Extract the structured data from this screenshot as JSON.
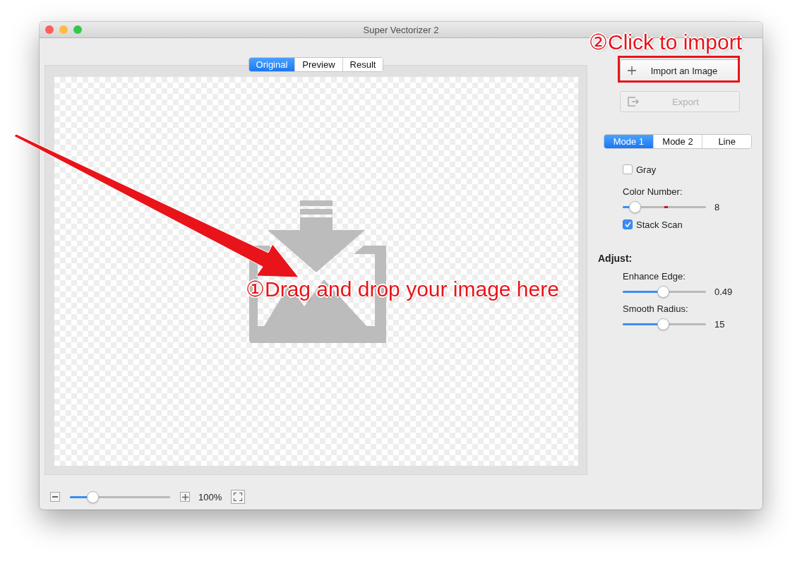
{
  "window": {
    "title": "Super Vectorizer 2"
  },
  "view_tabs": [
    {
      "label": "Original",
      "selected": true
    },
    {
      "label": "Preview",
      "selected": false
    },
    {
      "label": "Result",
      "selected": false
    }
  ],
  "buttons": [
    {
      "kind": "import",
      "label": "Import an Image",
      "disabled": false
    },
    {
      "kind": "export",
      "label": "Export",
      "disabled": true
    }
  ],
  "mode_tabs": [
    {
      "label": "Mode 1",
      "selected": true
    },
    {
      "label": "Mode 2",
      "selected": false
    },
    {
      "label": "Line",
      "selected": false
    }
  ],
  "options": [
    {
      "kind": "checkbox",
      "label": "Gray",
      "checked": false
    },
    {
      "kind": "slider",
      "label": "Color Number:",
      "level": 0.15,
      "reading": "8"
    },
    {
      "kind": "checkbox",
      "label": "Stack Scan",
      "checked": true
    }
  ],
  "adjust": {
    "title": "Adjust:",
    "sliders": [
      {
        "label": "Enhance Edge:",
        "level": 0.49,
        "reading": "0.49"
      },
      {
        "label": "Smooth Radius:",
        "level": 0.49,
        "reading": "15"
      }
    ]
  },
  "zoom": {
    "level": 0.23,
    "reading": "100%"
  },
  "annotations": {
    "drop_hint": "①Drag and drop your image here",
    "import_hint": "②Click to import"
  }
}
